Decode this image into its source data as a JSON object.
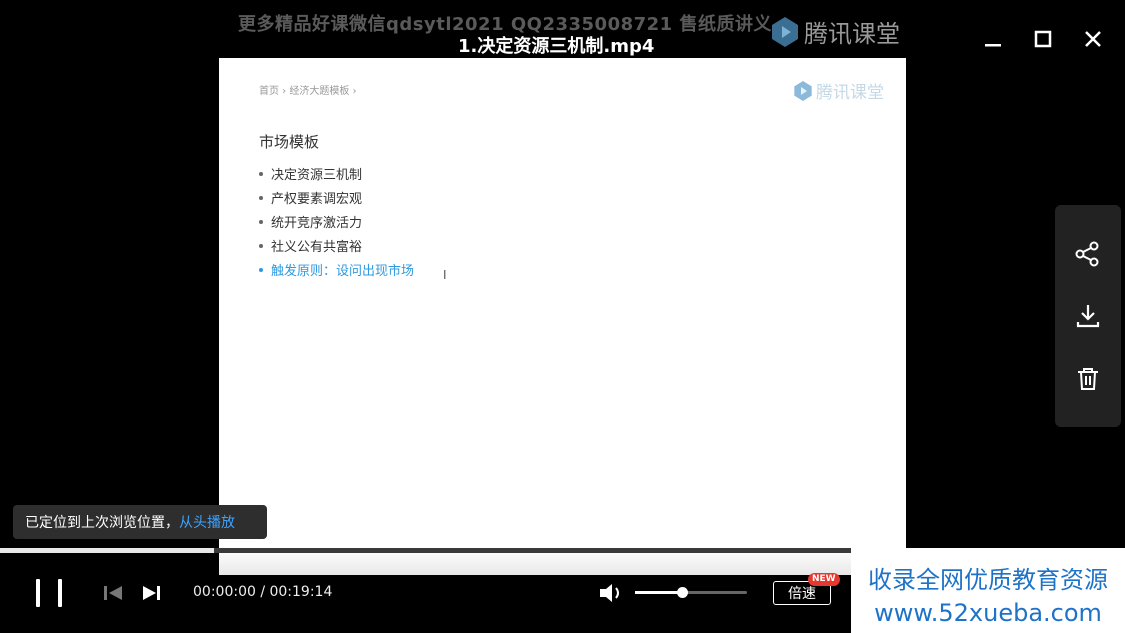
{
  "header": {
    "watermark_text": "更多精品好课微信qdsytl2021  QQ2335008721 售纸质讲义",
    "title": "1.决定资源三机制.mp4",
    "brand": "腾讯课堂"
  },
  "window_controls": [
    "minimize",
    "maximize",
    "close"
  ],
  "video": {
    "breadcrumb": "首页 › 经济大题模板 ›",
    "watermark": "腾讯课堂",
    "heading": "市场模板",
    "items": [
      {
        "text": "决定资源三机制"
      },
      {
        "text": "产权要素调宏观"
      },
      {
        "text": "统开竞序激活力"
      },
      {
        "text": "社义公有共富裕"
      },
      {
        "text": "触发原则：设问出现市场"
      }
    ],
    "cursor_glyph": "I"
  },
  "side_panel": {
    "icons": [
      "share-icon",
      "download-icon",
      "delete-icon"
    ]
  },
  "toast": {
    "message": "已定位到上次浏览位置，",
    "action": "从头播放"
  },
  "player": {
    "progress": 0.19,
    "current_time": "00:00:00",
    "duration": "00:19:14",
    "time_display": "00:00:00 / 00:19:14",
    "volume": 0.42,
    "speed_label": "倍速",
    "new_badge": "NEW"
  },
  "ad": {
    "line1": "收录全网优质教育资源",
    "line2": "www.52xueba.com"
  },
  "colors": {
    "background": "#000000",
    "link_blue": "#2e9ae0",
    "toast_link": "#3da3ff",
    "badge_red": "#e5382f",
    "ad_blue": "#1e73c8"
  }
}
